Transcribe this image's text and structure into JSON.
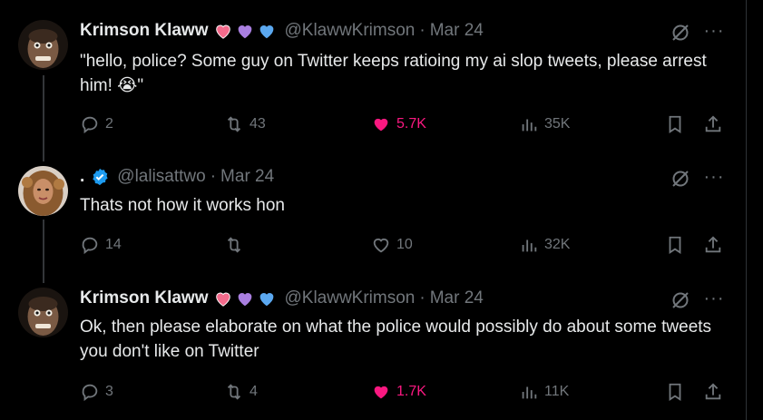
{
  "tweets": [
    {
      "name": "Krimson Klaww",
      "handle": "@KlawwKrimson",
      "separator": "·",
      "date": "Mar 24",
      "text": "\"hello, police? Some guy on Twitter keeps ratioing my ai slop tweets, please arrest him! 😭\"",
      "replies": "2",
      "retweets": "43",
      "likes": "5.7K",
      "views": "35K",
      "liked": true
    },
    {
      "name": ".",
      "handle": "@lalisattwo",
      "separator": "·",
      "date": "Mar 24",
      "text": "Thats not how it works hon",
      "replies": "14",
      "retweets": "",
      "likes": "10",
      "views": "32K",
      "liked": false
    },
    {
      "name": "Krimson Klaww",
      "handle": "@KlawwKrimson",
      "separator": "·",
      "date": "Mar 24",
      "text": "Ok, then please elaborate on what the police would possibly do about some tweets you don't like on Twitter",
      "replies": "3",
      "retweets": "4",
      "likes": "1.7K",
      "views": "11K",
      "liked": true
    }
  ],
  "colors": {
    "background": "#000000",
    "text": "#e7e9ea",
    "muted": "#71767b",
    "like": "#f91880",
    "verified": "#1d9bf0"
  },
  "icons": [
    "reply-icon",
    "retweet-icon",
    "heart-icon",
    "views-icon",
    "bookmark-icon",
    "share-icon",
    "grok-icon",
    "more-icon",
    "verified-icon"
  ]
}
